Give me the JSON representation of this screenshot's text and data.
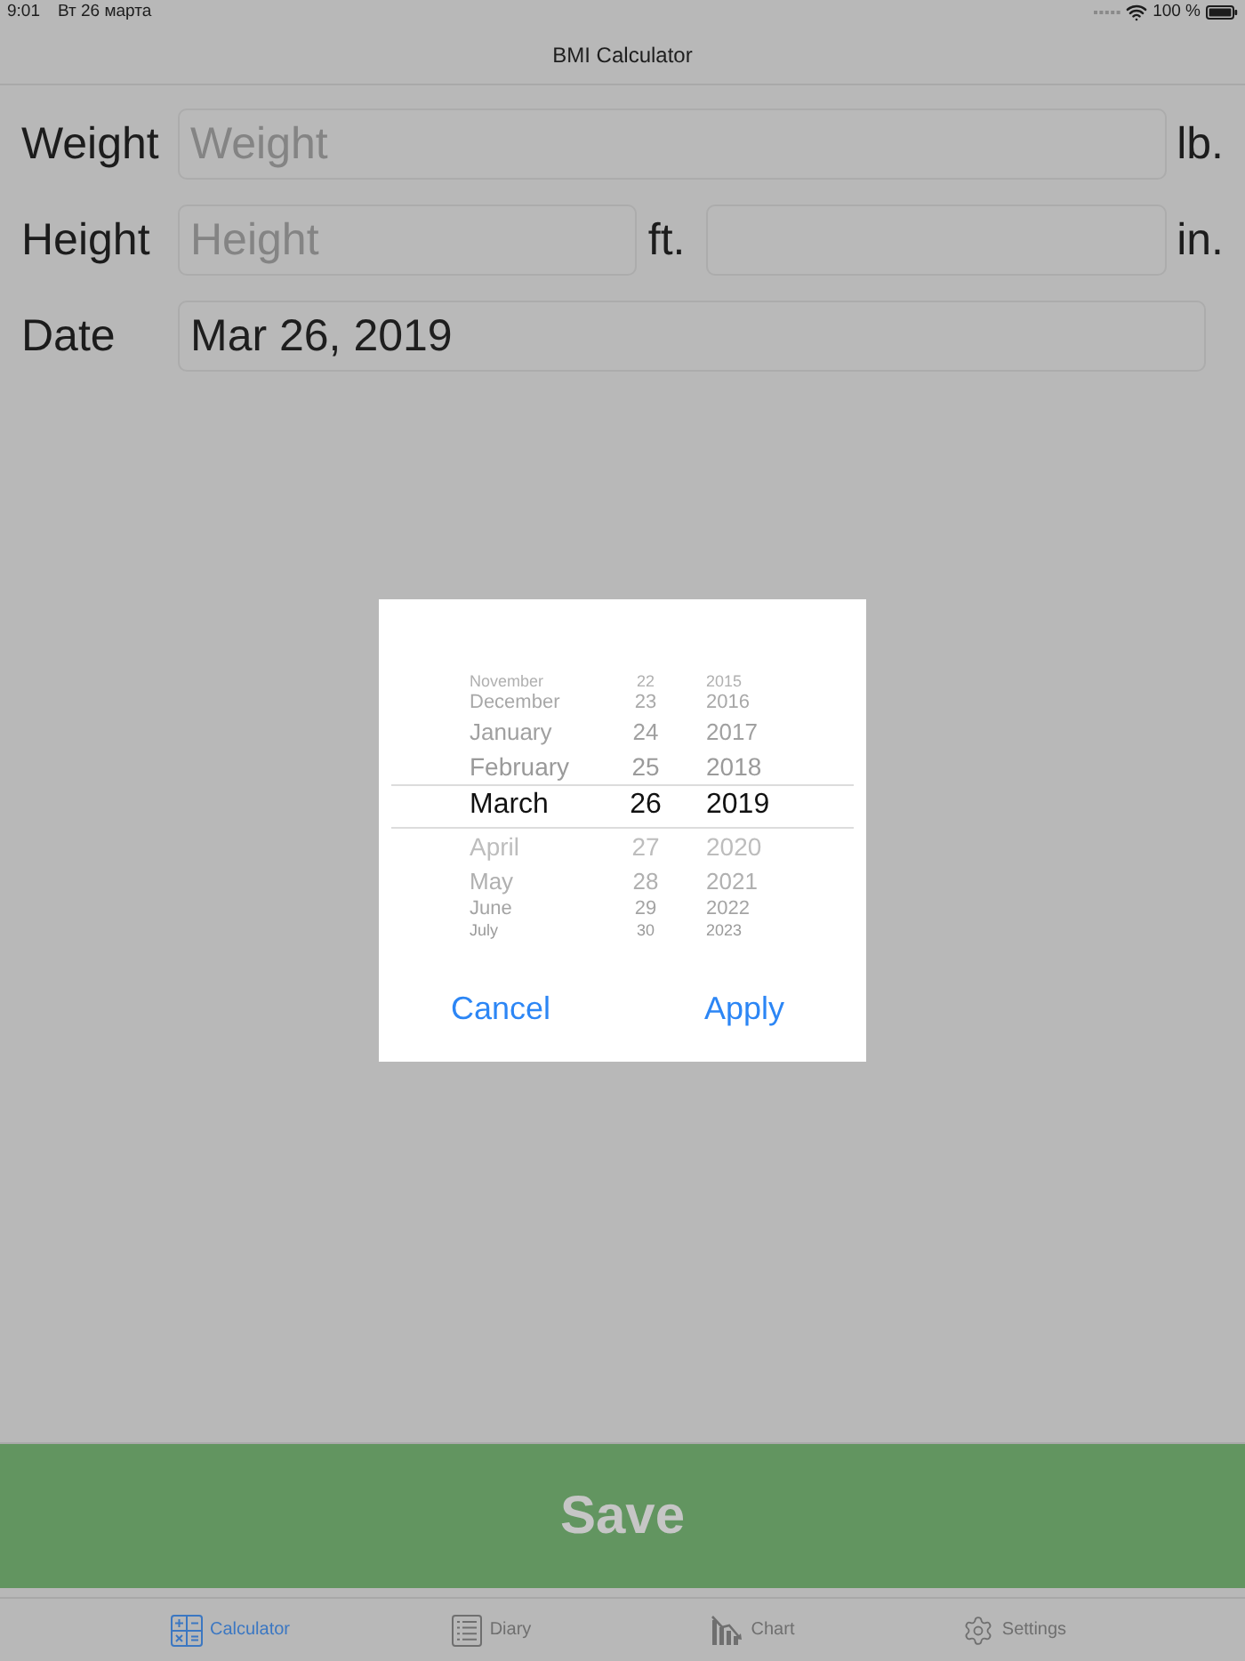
{
  "status_bar": {
    "time": "9:01",
    "date": "Вт 26 марта",
    "battery": "100 %"
  },
  "nav_bar": {
    "title": "BMI Calculator"
  },
  "form": [
    {
      "label": "Weight",
      "parts": [
        {
          "kind": "field",
          "placeholder": "Weight"
        },
        {
          "kind": "unit",
          "text": "lb."
        }
      ]
    },
    {
      "label": "Height",
      "parts": [
        {
          "kind": "field",
          "placeholder": "Height"
        },
        {
          "kind": "unit",
          "text": "ft."
        },
        {
          "kind": "field"
        },
        {
          "kind": "unit",
          "text": "in."
        }
      ]
    },
    {
      "label": "Date",
      "parts": [
        {
          "kind": "field",
          "value": "Mar 26, 2019"
        }
      ]
    }
  ],
  "save_button": {
    "label": "Save"
  },
  "date_dialog": {
    "picker": {
      "columns": [
        {
          "kind": "month",
          "items": [
            {
              "text": "November",
              "selected": false
            },
            {
              "text": "December",
              "selected": false
            },
            {
              "text": "January",
              "selected": false
            },
            {
              "text": "February",
              "selected": false
            },
            {
              "text": "March",
              "selected": true
            },
            {
              "text": "April",
              "selected": false
            },
            {
              "text": "May",
              "selected": false
            },
            {
              "text": "June",
              "selected": false
            },
            {
              "text": "July",
              "selected": false
            }
          ]
        },
        {
          "kind": "day",
          "items": [
            {
              "text": "22",
              "selected": false
            },
            {
              "text": "23",
              "selected": false
            },
            {
              "text": "24",
              "selected": false
            },
            {
              "text": "25",
              "selected": false
            },
            {
              "text": "26",
              "selected": true
            },
            {
              "text": "27",
              "selected": false
            },
            {
              "text": "28",
              "selected": false
            },
            {
              "text": "29",
              "selected": false
            },
            {
              "text": "30",
              "selected": false
            }
          ]
        },
        {
          "kind": "year",
          "items": [
            {
              "text": "2015",
              "selected": false
            },
            {
              "text": "2016",
              "selected": false
            },
            {
              "text": "2017",
              "selected": false
            },
            {
              "text": "2018",
              "selected": false
            },
            {
              "text": "2019",
              "selected": true
            },
            {
              "text": "2020",
              "selected": false
            },
            {
              "text": "2021",
              "selected": false
            },
            {
              "text": "2022",
              "selected": false
            },
            {
              "text": "2023",
              "selected": false
            }
          ]
        }
      ]
    },
    "buttons": [
      {
        "label": "Cancel"
      },
      {
        "label": "Apply"
      }
    ]
  },
  "tab_bar": {
    "items": [
      {
        "kind": "calculator",
        "label": "Calculator",
        "selected": true
      },
      {
        "kind": "diary",
        "label": "Diary",
        "selected": false
      },
      {
        "kind": "chart",
        "label": "Chart",
        "selected": false
      },
      {
        "kind": "settings",
        "label": "Settings",
        "selected": false
      }
    ]
  }
}
